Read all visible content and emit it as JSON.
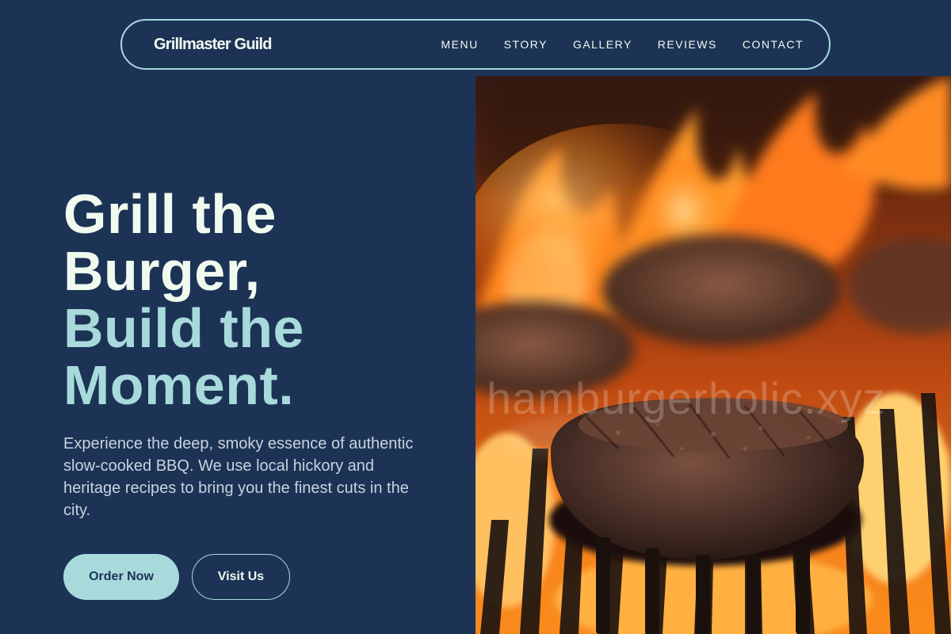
{
  "nav": {
    "brand": "Grillmaster Guild",
    "links": [
      "MENU",
      "STORY",
      "GALLERY",
      "REVIEWS",
      "CONTACT"
    ]
  },
  "hero": {
    "headline_lines": [
      "Grill the",
      "Burger,",
      "Build the",
      "Moment."
    ],
    "description": "Experience the deep, smoky essence of authentic slow-cooked BBQ. We use local hickory and heritage recipes to bring you the finest cuts in the city.",
    "primary_button": "Order Now",
    "secondary_button": "Visit Us"
  },
  "image": {
    "watermark": "hamburgerholic.xyz"
  },
  "colors": {
    "background": "#1c3356",
    "accent": "#a8dadc",
    "light_text": "#f1faee"
  }
}
